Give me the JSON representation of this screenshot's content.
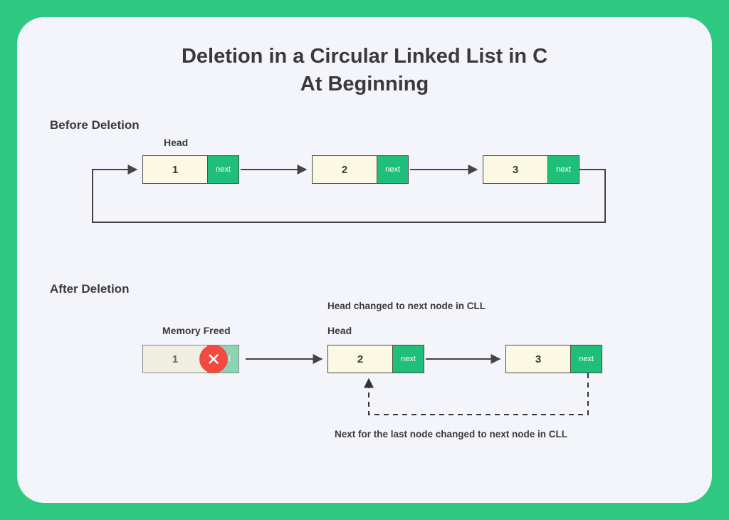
{
  "title_line1": "Deletion in a Circular Linked List in C",
  "title_line2": "At Beginning",
  "before": {
    "section": "Before Deletion",
    "head_label": "Head",
    "nodes": [
      {
        "value": "1",
        "next": "next"
      },
      {
        "value": "2",
        "next": "next"
      },
      {
        "value": "3",
        "next": "next"
      }
    ]
  },
  "after": {
    "section": "After Deletion",
    "memory_freed": "Memory Freed",
    "head_changed": "Head changed to next node in CLL",
    "head_label": "Head",
    "last_next_note": "Next for the last node changed to next node in CLL",
    "nodes": [
      {
        "value": "1",
        "next": "next"
      },
      {
        "value": "2",
        "next": "next"
      },
      {
        "value": "3",
        "next": "next"
      }
    ]
  },
  "colors": {
    "accent": "#2ec981",
    "node_fill": "#fbf9e2",
    "next_fill": "#20bf79",
    "error": "#f04b3e"
  }
}
